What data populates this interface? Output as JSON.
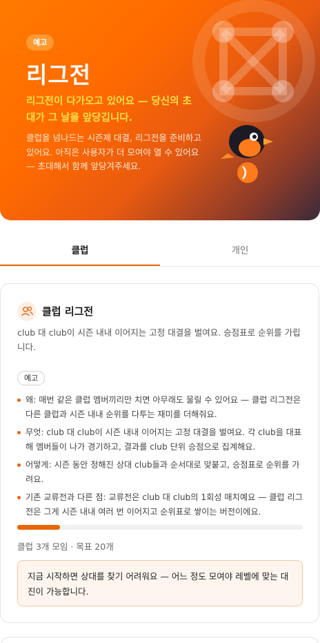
{
  "hero": {
    "badge": "예고",
    "title": "리그전",
    "subtitle": "리그전이 다가오고 있어요 — 당신의 초대가 그 날을 앞당깁니다.",
    "body": "클럽을 넘나드는 시즌제 대결, 리그전을 준비하고 있어요. 아직은 사용자가 더 모여야 열 수 있어요 — 초대해서 함께 앞당겨주세요.",
    "colors": {
      "accent": "#ff6a00",
      "subtitle": "#ffe04a"
    }
  },
  "tabs": [
    {
      "label": "클럽",
      "active": true
    },
    {
      "label": "개인",
      "active": false
    }
  ],
  "card": {
    "icon": "users-icon",
    "title": "클럽 리그전",
    "description": "club 대 club이 시즌 내내 이어지는 고정 대결을 벌여요. 승점표로 순위를 가립니다.",
    "badge": "예고",
    "bullets": [
      "왜: 매번 같은 클럽 멤버끼리만 치면 아무래도 물릴 수 있어요 — 클럽 리그전은 다른 클럽과 시즌 내내 순위를 다투는 재미를 더해줘요.",
      "무엇: club 대 club이 시즌 내내 이어지는 고정 대결을 벌여요. 각 club을 대표해 멤버들이 나가 경기하고, 결과를 club 단위 승점으로 집계해요.",
      "어떻게: 시즌 동안 정해진 상대 club들과 순서대로 맞붙고, 승점표로 순위를 가려요.",
      "기존 교류전과 다른 점: 교류전은 club 대 club의 1회성 매치예요 — 클럽 리그전은 그게 시즌 내내 여러 번 이어지고 순위표로 쌓이는 버전이에요."
    ],
    "progress": {
      "current": 3,
      "goal": 20,
      "fraction": 0.15
    },
    "progress_text": "클럽 3개 모임 · 목표 20개",
    "notice": "지금 시작하면 상대를 찾기 어려워요 — 어느 정도 모여야 레벨에 맞는 대진이 가능합니다."
  }
}
